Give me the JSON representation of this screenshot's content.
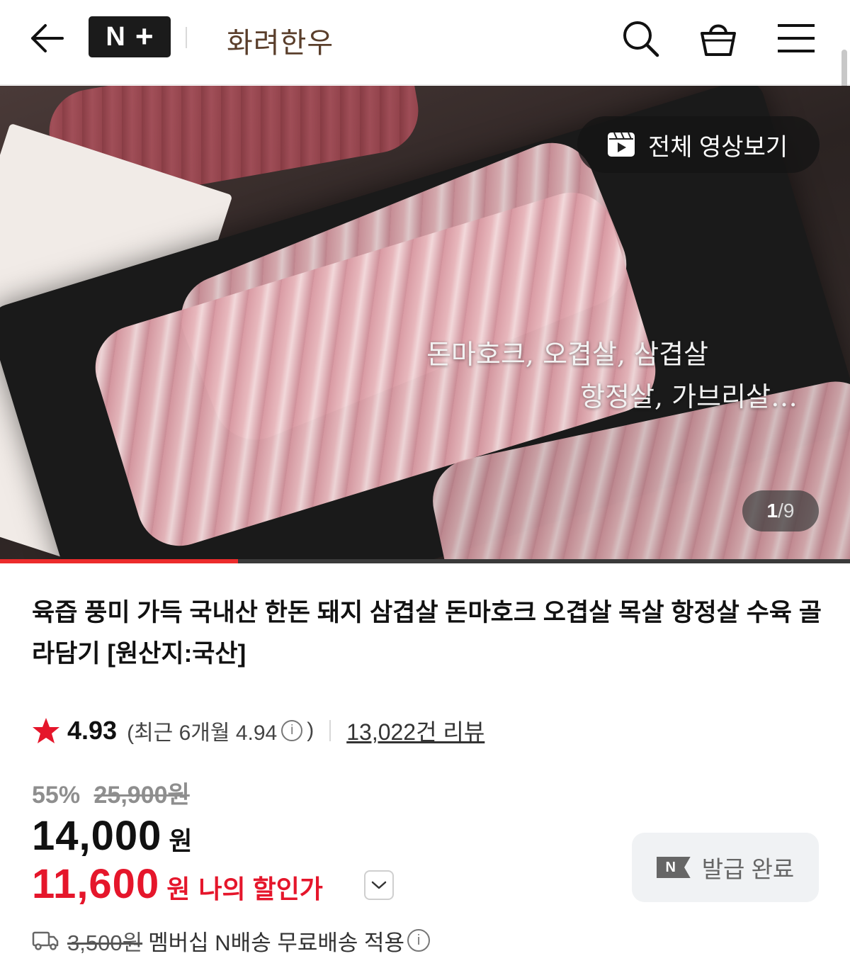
{
  "header": {
    "brand_badge": "N+",
    "store_name": "화려한우"
  },
  "media": {
    "video_label": "전체 영상보기",
    "caption_line1": "돈마호크, 오겹살, 삼겹살",
    "caption_line2": "항정살, 가브리살…",
    "counter_current": "1",
    "counter_separator": "/",
    "counter_total": "9",
    "progress_fraction": 0.28
  },
  "product": {
    "title": "육즙 풍미 가득 국내산 한돈 돼지 삼겹살 돈마호크 오겹살 목살 항정살 수육 골라담기 [원산지:국산]",
    "rating": "4.93",
    "recent_rating_prefix": "(최근 6개월 4.94",
    "recent_rating_suffix": ")",
    "review_count": "13,022건 리뷰",
    "discount_percent": "55%",
    "original_price": "25,900원",
    "price": "14,000",
    "price_unit": "원",
    "my_price": "11,600",
    "my_price_unit": "원",
    "my_price_label": "나의 할인가",
    "coupon_badge": "N",
    "coupon_label": "발급 완료",
    "shipping_fee": "3,500원",
    "shipping_text": "멤버십 N배송 무료배송 적용"
  },
  "colors": {
    "accent_red": "#e5162b",
    "progress_red": "#ec2c2c",
    "brand_brown": "#5a3e2b",
    "star": "#e5162b"
  },
  "icons": [
    "back-arrow-icon",
    "search-icon",
    "shopping-bag-icon",
    "hamburger-menu-icon",
    "video-play-icon",
    "star-icon",
    "info-icon",
    "chevron-down-icon",
    "truck-icon"
  ]
}
